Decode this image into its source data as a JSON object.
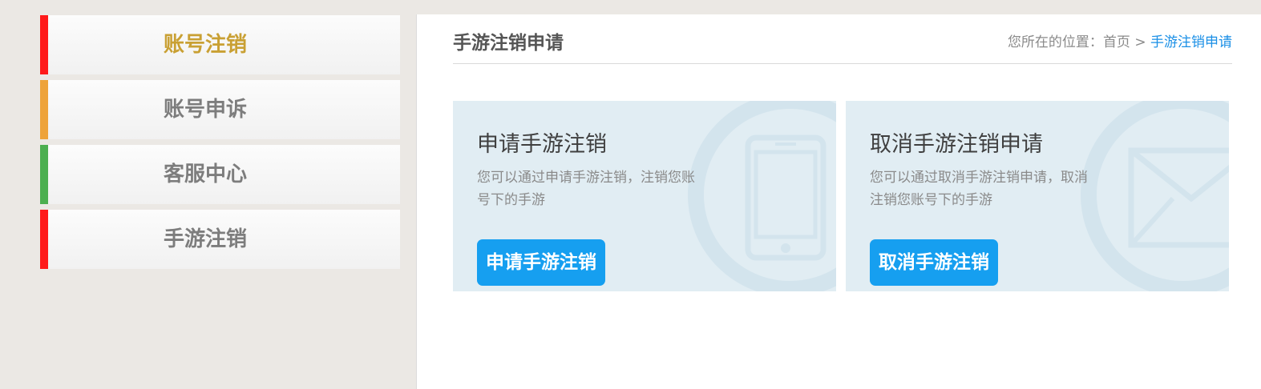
{
  "sidebar": {
    "items": [
      {
        "label": "账号注销",
        "accent": "#ff1a1a",
        "active": true
      },
      {
        "label": "账号申诉",
        "accent": "#eea33a",
        "active": false
      },
      {
        "label": "客服中心",
        "accent": "#4caf50",
        "active": false
      },
      {
        "label": "手游注销",
        "accent": "#ff1a1a",
        "active": false
      }
    ]
  },
  "header": {
    "title": "手游注销申请",
    "breadcrumb": {
      "prefix": "您所在的位置：",
      "home": "首页",
      "separator": ">",
      "current": "手游注销申请"
    }
  },
  "cards": [
    {
      "title": "申请手游注销",
      "desc": "您可以通过申请手游注销，注销您账号下的手游",
      "button": "申请手游注销",
      "icon": "phone-icon"
    },
    {
      "title": "取消手游注销申请",
      "desc": "您可以通过取消手游注销申请，取消注销您账号下的手游",
      "button": "取消手游注销",
      "icon": "envelope-icon"
    }
  ],
  "colors": {
    "accent_blue": "#169ff0",
    "active_text": "#c9a033",
    "card_bg": "#e1edf3"
  }
}
